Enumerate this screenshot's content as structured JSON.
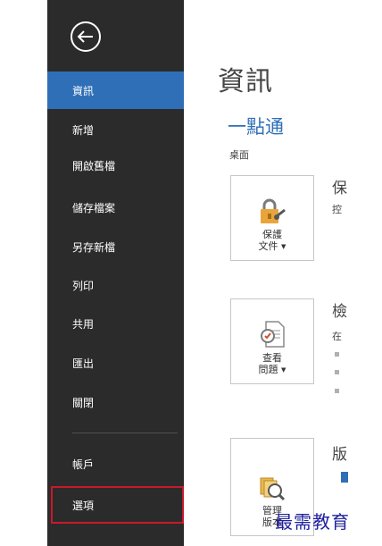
{
  "sidebar": {
    "items": [
      {
        "label": "資訊",
        "active": true
      },
      {
        "label": "新增"
      },
      {
        "label": "開啟舊檔"
      },
      {
        "label": "儲存檔案"
      },
      {
        "label": "另存新檔"
      },
      {
        "label": "列印"
      },
      {
        "label": "共用"
      },
      {
        "label": "匯出"
      },
      {
        "label": "關閉"
      },
      {
        "label": "帳戶"
      },
      {
        "label": "選項",
        "highlighted": true
      }
    ]
  },
  "main": {
    "title": "資訊",
    "doc_name": "一點通",
    "doc_path": "桌面",
    "sections": [
      {
        "tile_line1": "保護",
        "tile_line2": "文件",
        "title": "保",
        "desc": "控"
      },
      {
        "tile_line1": "查看",
        "tile_line2": "問題",
        "title": "檢",
        "desc": "在"
      },
      {
        "tile_line1": "管理",
        "tile_line2": "版本",
        "title": "版",
        "desc": ""
      }
    ]
  },
  "watermark": "最需教育",
  "colors": {
    "sidebar_bg": "#2b2b2b",
    "active_bg": "#2f6fb7",
    "highlight_border": "#c8192b",
    "accent": "#2f6fb7"
  }
}
